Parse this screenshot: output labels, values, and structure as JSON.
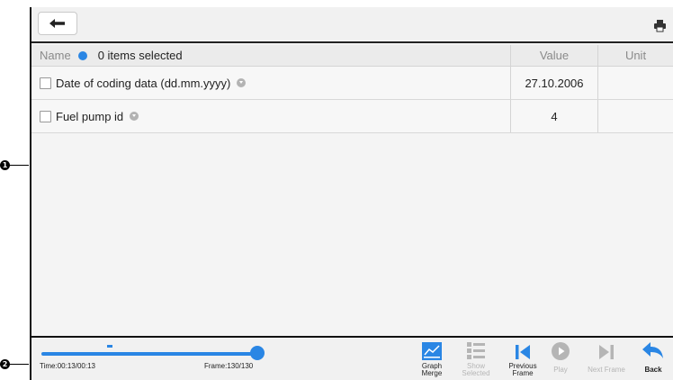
{
  "callouts": [
    "1",
    "2"
  ],
  "toolbar_top": {
    "back_icon": "arrow-left-icon",
    "print_icon": "printer-icon"
  },
  "table": {
    "header": {
      "name": "Name",
      "selection": "0 items selected",
      "value": "Value",
      "unit": "Unit"
    },
    "rows": [
      {
        "name": "Date of coding data (dd.mm.yyyy)",
        "value": "27.10.2006",
        "unit": ""
      },
      {
        "name": "Fuel pump id",
        "value": "4",
        "unit": ""
      }
    ]
  },
  "playback": {
    "time": "Time:00:13/00:13",
    "frame": "Frame:130/130",
    "progress": 1.0
  },
  "toolbar_bottom": {
    "graph_merge": "Graph\nMerge",
    "show_selected": "Show\nSelected",
    "previous_frame": "Previous\nFrame",
    "play": "Play",
    "next_frame": "Next Frame",
    "back": "Back"
  },
  "colors": {
    "accent": "#2a86e4",
    "disabled": "#b5b5b5"
  }
}
